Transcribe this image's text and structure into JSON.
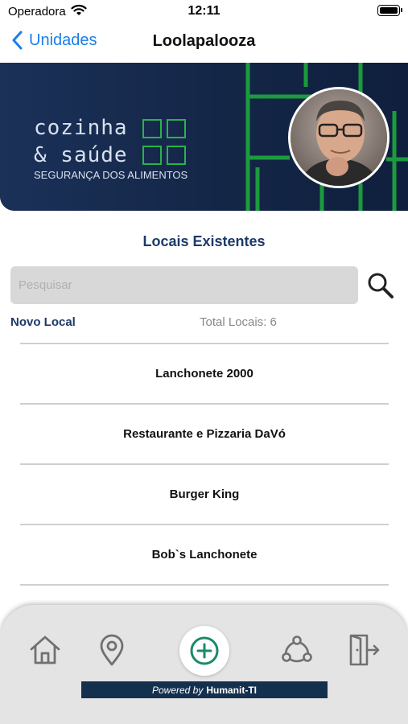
{
  "status_bar": {
    "carrier": "Operadora",
    "time": "12:11"
  },
  "nav": {
    "back_label": "Unidades",
    "title": "Loolapalooza"
  },
  "banner": {
    "brand_line1": "cozinha",
    "brand_line2": "& saúde",
    "brand_sub": "SEGURANÇA DOS ALIMENTOS",
    "accent_color": "#2bb24c",
    "background_color": "#15284b"
  },
  "main": {
    "section_title": "Locais Existentes",
    "search_placeholder": "Pesquisar",
    "search_value": "",
    "novo_local_label": "Novo Local",
    "total_label": "Total Locais: 6",
    "items": [
      {
        "label": "Lanchonete 2000"
      },
      {
        "label": "Restaurante e Pizzaria DaVó"
      },
      {
        "label": "Burger King"
      },
      {
        "label": "Bob`s Lanchonete"
      }
    ]
  },
  "tabbar": {
    "icons": [
      "home-icon",
      "location-pin-icon",
      "add-circle-icon",
      "network-icon",
      "exit-door-icon"
    ],
    "powered_prefix": "Powered by",
    "powered_brand": "Humanit-TI",
    "accent_color": "#1a8a6a"
  }
}
